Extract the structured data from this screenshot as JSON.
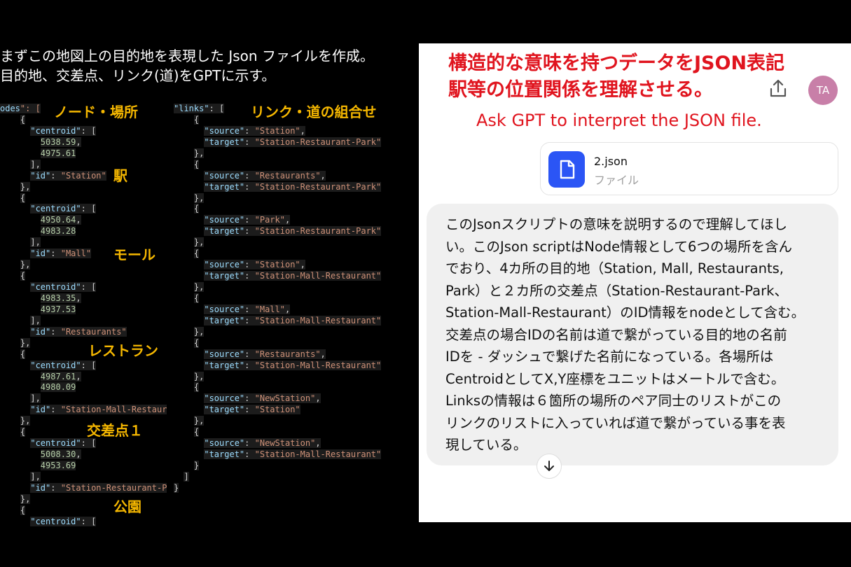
{
  "intro": {
    "line1": "まずこの地図上の目的地を表現した Json ファイルを作成。",
    "line2": "目的地、交差点、リンク(道)をGPTに示す。"
  },
  "labels": {
    "nodes": "ノード・場所",
    "links": "リンク・道の組合せ",
    "station": "駅",
    "mall": "モール",
    "restaurant": "レストラン",
    "crossing": "交差点１",
    "park": "公園"
  },
  "code_left": [
    "odes\": [",
    "    {",
    "      \"centroid\": [",
    "        5038.59,",
    "        4975.61",
    "      ],",
    "      \"id\": \"Station\"",
    "    },",
    "    {",
    "      \"centroid\": [",
    "        4950.64,",
    "        4983.28",
    "      ],",
    "      \"id\": \"Mall\"",
    "    },",
    "    {",
    "      \"centroid\": [",
    "        4983.35,",
    "        4937.53",
    "      ],",
    "      \"id\": \"Restaurants\"",
    "    },",
    "    {",
    "      \"centroid\": [",
    "        4987.61,",
    "        4980.09",
    "      ],",
    "      \"id\": \"Station-Mall-Restaur",
    "    },",
    "    {",
    "      \"centroid\": [",
    "        5008.30,",
    "        4953.69",
    "      ],",
    "      \"id\": \"Station-Restaurant-P",
    "    },",
    "    {",
    "      \"centroid\": ["
  ],
  "code_right": [
    "\"links\": [",
    "    {",
    "      \"source\": \"Station\",",
    "      \"target\": \"Station-Restaurant-Park\"",
    "    },",
    "    {",
    "      \"source\": \"Restaurants\",",
    "      \"target\": \"Station-Restaurant-Park\"",
    "    },",
    "    {",
    "      \"source\": \"Park\",",
    "      \"target\": \"Station-Restaurant-Park\"",
    "    },",
    "    {",
    "      \"source\": \"Station\",",
    "      \"target\": \"Station-Mall-Restaurant\"",
    "    },",
    "    {",
    "      \"source\": \"Mall\",",
    "      \"target\": \"Station-Mall-Restaurant\"",
    "    },",
    "    {",
    "      \"source\": \"Restaurants\",",
    "      \"target\": \"Station-Mall-Restaurant\"",
    "    },",
    "    {",
    "      \"source\": \"NewStation\",",
    "      \"target\": \"Station\"",
    "    },",
    "    {",
    "      \"source\": \"NewStation\",",
    "      \"target\": \"Station-Mall-Restaurant\"",
    "    }",
    "  ]",
    "}"
  ],
  "panel": {
    "heading1": "構造的な意味を持つデータをJSON表記",
    "heading2": "駅等の位置関係を理解させる。",
    "english": "Ask GPT to interpret the JSON file.",
    "avatar": "TA",
    "file_name": "2.json",
    "file_type": "ファイル",
    "message": [
      "このJsonスクリプトの意味を説明するので理解してほし",
      "い。このJson scriptはNode情報として6つの場所を含ん",
      "でおり、4カ所の目的地（Station, Mall, Restaurants,",
      "Park）と２カ所の交差点（Station-Restaurant-Park、",
      "Station-Mall-Restaurant）のID情報をnodeとして含む。",
      "交差点の場合IDの名前は道で繋がっている目的地の名前",
      "IDを - ダッシュで繋げた名前になっている。各場所は",
      "CentroidとしてX,Y座標をユニットはメートルで含む。",
      "Linksの情報は６箇所の場所のペア同士のリストがこの",
      "リンクのリストに入っていれば道で繋がっている事を表",
      "現している。"
    ]
  },
  "colors": {
    "heading_red": "#e0141e",
    "label_yellow": "#f5b700",
    "file_icon_blue": "#2b55f5",
    "avatar": "#c87fa8"
  }
}
